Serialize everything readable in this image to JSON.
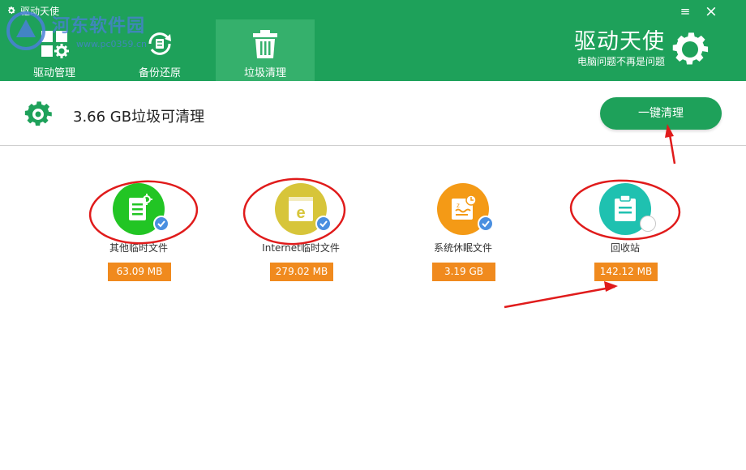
{
  "window": {
    "title": "驱动天使",
    "menu_icon": "≡",
    "close_icon": "×"
  },
  "nav": {
    "tabs": [
      {
        "label": "驱动管理",
        "icon": "grid-gear-icon",
        "active": false
      },
      {
        "label": "备份还原",
        "icon": "backup-restore-icon",
        "active": false
      },
      {
        "label": "垃圾清理",
        "icon": "trash-can-icon",
        "active": true
      }
    ]
  },
  "brand": {
    "title": "驱动天使",
    "subtitle": "电脑问题不再是问题"
  },
  "watermark": {
    "text": "河东软件园",
    "url": "www.pc0359.cn"
  },
  "summary": {
    "text": "3.66 GB垃圾可清理",
    "clean_button": "一键清理"
  },
  "items": [
    {
      "label": "其他临时文件",
      "size": "63.09 MB",
      "color": "#22c524",
      "icon": "document-gear-icon",
      "checked": true
    },
    {
      "label": "Internet临时文件",
      "size": "279.02 MB",
      "color": "#d7c53a",
      "icon": "internet-explorer-icon",
      "checked": true
    },
    {
      "label": "系统休眠文件",
      "size": "3.19 GB",
      "color": "#f49a16",
      "icon": "sleep-file-icon",
      "checked": true
    },
    {
      "label": "回收站",
      "size": "142.12 MB",
      "color": "#1fc1b0",
      "icon": "recycle-clipboard-icon",
      "checked": false
    }
  ],
  "colors": {
    "brand_green": "#1ea15a",
    "active_tab": "#35b06c",
    "size_badge": "#f08a1e",
    "checkbox_blue": "#4a8fe0",
    "annotation_red": "#e01b1b"
  }
}
